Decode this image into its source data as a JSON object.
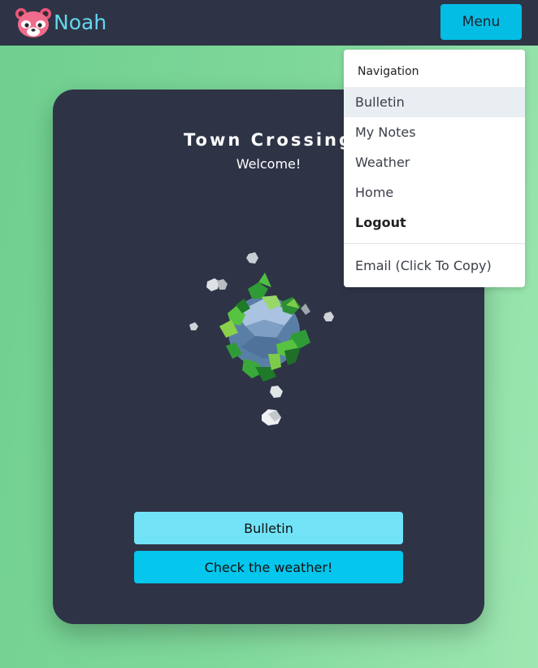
{
  "header": {
    "brand_name": "Noah",
    "logo_icon": "red-panda-icon",
    "menu_label": "Menu"
  },
  "card": {
    "title": "Town Crossing",
    "subtitle": "Welcome!",
    "illustration": "low-poly-planet",
    "bulletin_button": "Bulletin",
    "weather_button": "Check the weather!"
  },
  "dropdown": {
    "header": "Navigation",
    "items": [
      {
        "label": "Bulletin"
      },
      {
        "label": "My Notes"
      },
      {
        "label": "Weather"
      },
      {
        "label": "Home"
      },
      {
        "label": "Logout"
      }
    ],
    "email_item": "Email (Click To Copy)"
  },
  "colors": {
    "topbar": "#2e3446",
    "accent": "#03bde4",
    "accent_light": "#72e3f7",
    "brand_text": "#65d6ee",
    "background_green": "#7fd89a"
  }
}
